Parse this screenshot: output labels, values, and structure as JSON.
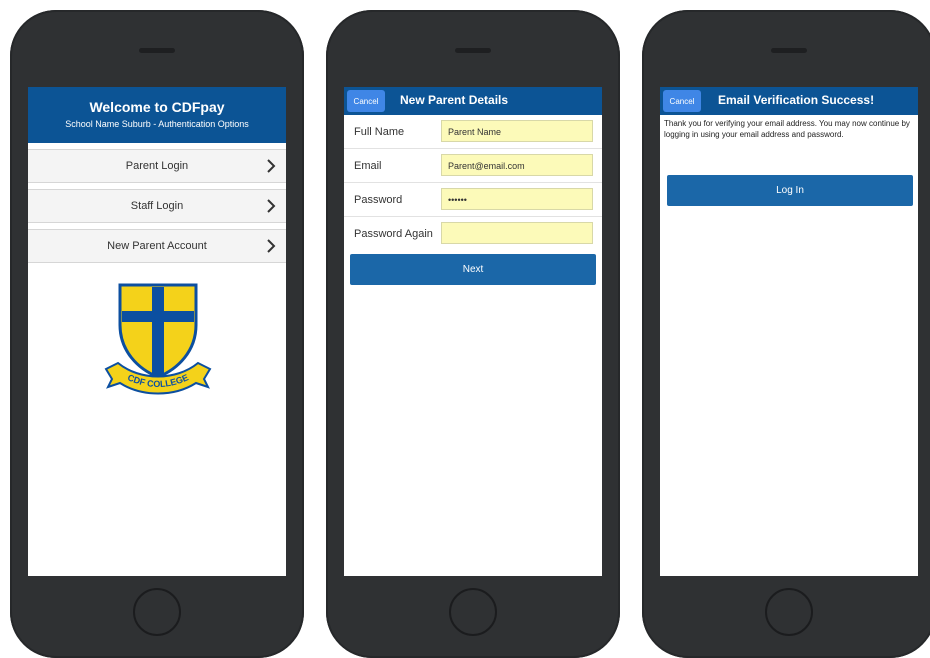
{
  "screen1": {
    "title": "Welcome to CDFpay",
    "subtitle": "School Name Suburb - Authentication Options",
    "options": [
      {
        "label": "Parent Login"
      },
      {
        "label": "Staff Login"
      },
      {
        "label": "New Parent Account"
      }
    ],
    "crest_text": "CDF COLLEGE"
  },
  "screen2": {
    "cancel_label": "Cancel",
    "title": "New Parent Details",
    "fields": [
      {
        "label": "Full Name",
        "value": "Parent Name"
      },
      {
        "label": "Email",
        "value": "Parent@email.com"
      },
      {
        "label": "Password",
        "value": "••••••"
      },
      {
        "label": "Password Again",
        "value": ""
      }
    ],
    "next_label": "Next"
  },
  "screen3": {
    "cancel_label": "Cancel",
    "title": "Email Verification Success!",
    "message": "Thank you for verifying your email address.  You may now continue by logging in using your email address and password.",
    "login_label": "Log In"
  },
  "colors": {
    "header": "#0c5495",
    "button": "#1b67a8",
    "cancel": "#3f86e6",
    "input_bg": "#fcfab9",
    "phone": "#2f3133"
  }
}
